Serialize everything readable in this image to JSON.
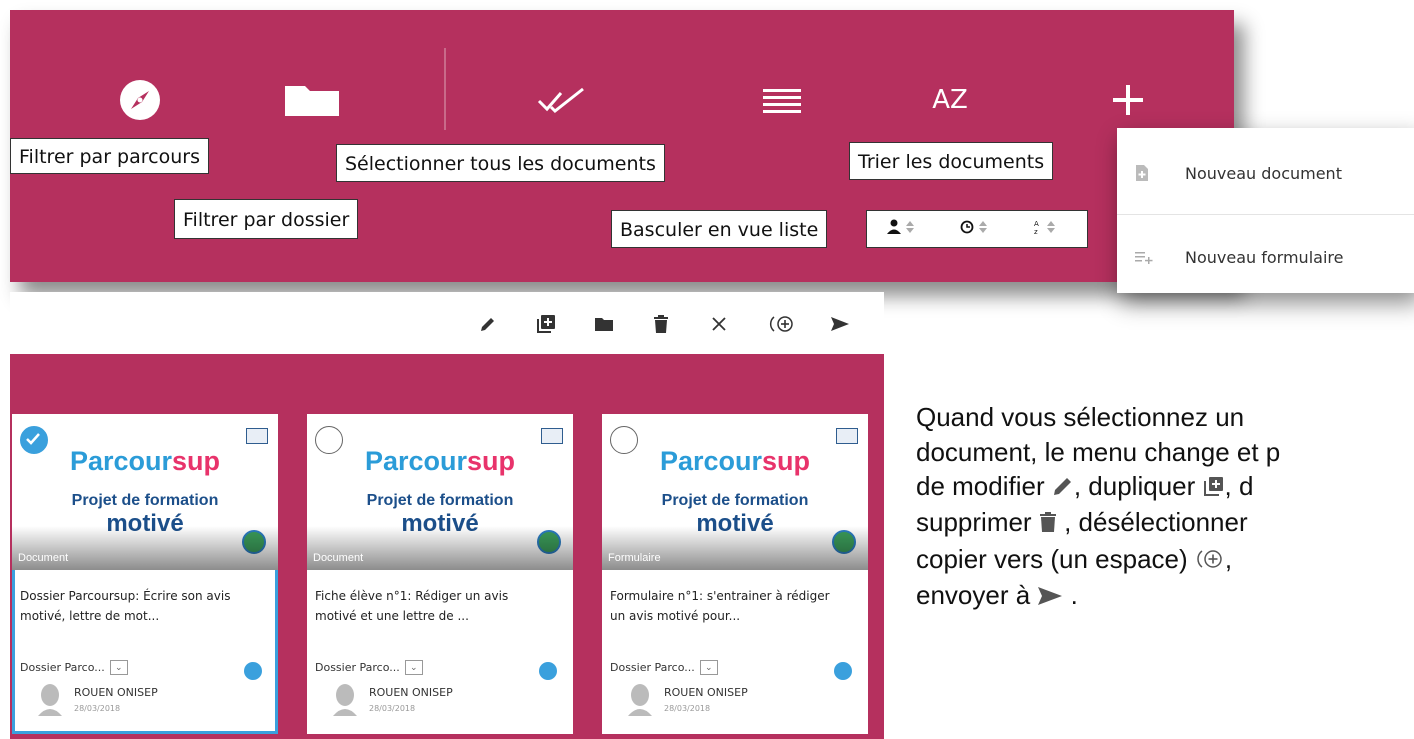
{
  "toolbar": {
    "tooltips": {
      "filter_path": "Filtrer par parcours",
      "filter_folder": "Filtrer par dossier",
      "select_all": "Sélectionner tous les documents",
      "list_view": "Basculer en vue liste",
      "sort": "Trier les documents"
    },
    "icons": [
      "compass-icon",
      "folder-icon",
      "double-check-icon",
      "list-icon",
      "sort-az-icon",
      "plus-icon"
    ],
    "az_label": "AZ",
    "sort_options": [
      "sort-by-owner-icon",
      "sort-by-date-icon",
      "sort-by-name-icon"
    ],
    "background": "#b5305e"
  },
  "new_menu": {
    "items": [
      {
        "label": "Nouveau document",
        "icon": "new-document-icon"
      },
      {
        "label": "Nouveau formulaire",
        "icon": "new-form-icon"
      }
    ]
  },
  "action_bar": {
    "icons": [
      "edit-icon",
      "duplicate-icon",
      "move-folder-icon",
      "delete-icon",
      "deselect-icon",
      "copy-to-icon",
      "send-icon"
    ]
  },
  "cards": [
    {
      "selected": true,
      "brand_a": "Parcour",
      "brand_b": "sup",
      "subtitle1": "Projet de formation",
      "subtitle2": "motivé",
      "type": "Document",
      "title_line1": "Dossier Parcoursup: Écrire son avis",
      "title_line2": "motivé, lettre de mot...",
      "folder": "Dossier Parco...",
      "owner": "ROUEN ONISEP",
      "date": "28/03/2018"
    },
    {
      "selected": false,
      "brand_a": "Parcour",
      "brand_b": "sup",
      "subtitle1": "Projet de formation",
      "subtitle2": "motivé",
      "type": "Document",
      "title_line1": "Fiche élève n°1: Rédiger un avis",
      "title_line2": "motivé et une lettre de ...",
      "folder": "Dossier Parco...",
      "owner": "ROUEN ONISEP",
      "date": "28/03/2018"
    },
    {
      "selected": false,
      "brand_a": "Parcour",
      "brand_b": "sup",
      "subtitle1": "Projet de formation",
      "subtitle2": "motivé",
      "type": "Formulaire",
      "title_line1": "Formulaire n°1: s'entrainer à rédiger",
      "title_line2": "un avis motivé pour...",
      "folder": "Dossier Parco...",
      "owner": "ROUEN ONISEP",
      "date": "28/03/2018"
    }
  ],
  "explanation": {
    "line1": "Quand vous sélectionnez un",
    "line2": "document, le menu change et p",
    "line3a": "de modifier",
    "line3b": ", dupliquer",
    "line3c": ", d",
    "line4a": "supprimer",
    "line4b": ", désélectionner",
    "line5a": "copier vers (un espace)",
    "line5b": ",",
    "line6a": "envoyer à",
    "line6b": "."
  },
  "colors": {
    "accent": "#b5305e",
    "selection": "#3aa0dd",
    "brand_blue": "#2b9cd8",
    "brand_pink": "#e8336b",
    "brand_navy": "#1c4f8a"
  }
}
